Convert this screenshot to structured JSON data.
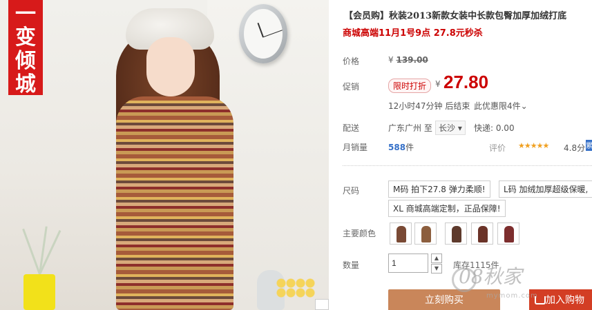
{
  "photo": {
    "banner_text": [
      "变",
      "倾",
      "城"
    ],
    "banner_prefix": "一"
  },
  "product": {
    "title": "【会员购】秋装2013新款女装中长款包臀加厚加绒打底",
    "subtitle": "商城高端11月1号9点 27.8元秒杀"
  },
  "labels": {
    "price": "价格",
    "promo": "促销",
    "shipping": "配送",
    "monthly_sales": "月销量",
    "size": "尺码",
    "color": "主要颜色",
    "quantity": "数量"
  },
  "price": {
    "original_currency": "¥",
    "original": "139.00",
    "promo_badge": "限时打折",
    "currency": "¥",
    "current": "27.80",
    "countdown": "12小时47分钟 后结束",
    "limit": "此优惠限4件",
    "limit_arrow": "⌄"
  },
  "shipping": {
    "from": "广东广州 至",
    "to": "长沙",
    "to_arrow": "▾",
    "fee": "快递: 0.00"
  },
  "sales": {
    "count": "588",
    "unit": "件",
    "rating_label": "评价",
    "stars": "★★★★★",
    "score": "4.8分",
    "extra": "累"
  },
  "sizes": [
    "M码 拍下27.8 弹力柔顺!",
    "L码 加绒加厚超级保暖,",
    "XL 商城高端定制，正品保障!"
  ],
  "colors": {
    "swatches": [
      "#7a4a35",
      "#8c5e3e",
      "#5e3a2c",
      "#6b3328",
      "#7d2e2e"
    ]
  },
  "quantity": {
    "value": "1",
    "stock": "库存1115件",
    "up": "▲",
    "down": "▼"
  },
  "actions": {
    "buy_now": "立刻购买",
    "add_to_cart": "加入购物"
  },
  "watermark": {
    "text": "08秋家",
    "sub": "mymom.com"
  }
}
